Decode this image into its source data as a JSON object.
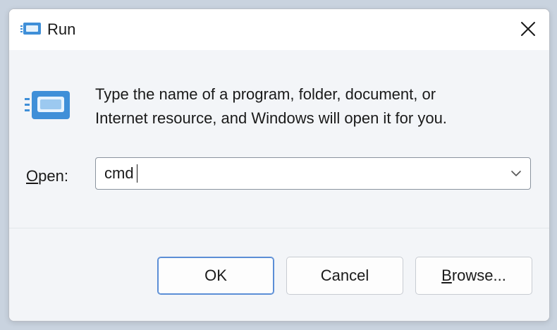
{
  "window": {
    "title": "Run",
    "icon": "run-icon",
    "close_icon": "close-icon"
  },
  "content": {
    "description_line1": "Type the name of a program, folder, document, or",
    "description_line2": "Internet resource, and Windows will open it for you.",
    "open_label_mnemonic": "O",
    "open_label_rest": "pen:",
    "open_value": "cmd",
    "dropdown_icon": "chevron-down-icon"
  },
  "buttons": {
    "ok": "OK",
    "cancel": "Cancel",
    "browse_mnemonic": "B",
    "browse_rest": "rowse..."
  },
  "colors": {
    "accent": "#5b8ed6",
    "dialog_bg": "#ffffff",
    "content_bg": "#f3f5f8",
    "icon_blue": "#3f8fd8",
    "watermark": "#e8c9c4"
  }
}
